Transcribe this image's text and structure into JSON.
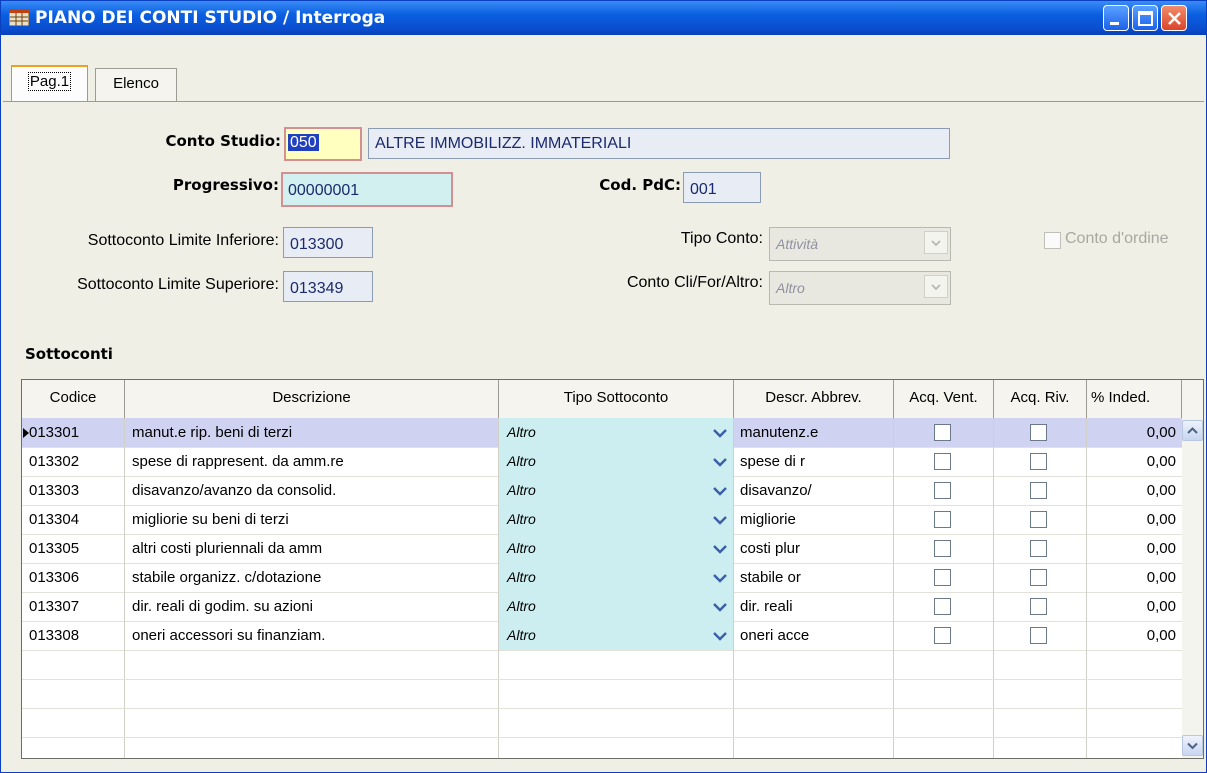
{
  "window": {
    "title": "PIANO DEI CONTI STUDIO / Interroga"
  },
  "tabs": [
    {
      "label": "Pag.1",
      "active": true
    },
    {
      "label": "Elenco",
      "active": false
    }
  ],
  "form": {
    "conto_studio": {
      "label": "Conto Studio:",
      "code": "050",
      "description": "ALTRE IMMOBILIZZ. IMMATERIALI"
    },
    "progressivo": {
      "label": "Progressivo:",
      "value": "00000001"
    },
    "cod_pdc": {
      "label": "Cod. PdC:",
      "value": "001"
    },
    "limite_inferiore": {
      "label": "Sottoconto Limite Inferiore:",
      "value": "013300"
    },
    "limite_superiore": {
      "label": "Sottoconto Limite Superiore:",
      "value": "013349"
    },
    "tipo_conto": {
      "label": "Tipo Conto:",
      "value": "Attività"
    },
    "conto_cli_for": {
      "label": "Conto Cli/For/Altro:",
      "value": "Altro"
    },
    "conto_ordine": {
      "label": "Conto d'ordine",
      "checked": false
    }
  },
  "sottoconti": {
    "section_title": "Sottoconti",
    "columns": [
      "Codice",
      "Descrizione",
      "Tipo Sottoconto",
      "Descr. Abbrev.",
      "Acq. Vent.",
      "Acq. Riv.",
      "% Inded."
    ],
    "rows": [
      {
        "codice": "013301",
        "descrizione": "manut.e rip. beni di terzi",
        "tipo": "Altro",
        "abbrev": "manutenz.e",
        "acq_vent": false,
        "acq_riv": false,
        "inded": "0,00"
      },
      {
        "codice": "013302",
        "descrizione": "spese di rappresent. da amm.re",
        "tipo": "Altro",
        "abbrev": "spese di r",
        "acq_vent": false,
        "acq_riv": false,
        "inded": "0,00"
      },
      {
        "codice": "013303",
        "descrizione": "disavanzo/avanzo da consolid.",
        "tipo": "Altro",
        "abbrev": "disavanzo/",
        "acq_vent": false,
        "acq_riv": false,
        "inded": "0,00"
      },
      {
        "codice": "013304",
        "descrizione": "migliorie su beni di terzi",
        "tipo": "Altro",
        "abbrev": "migliorie",
        "acq_vent": false,
        "acq_riv": false,
        "inded": "0,00"
      },
      {
        "codice": "013305",
        "descrizione": "altri costi pluriennali da amm",
        "tipo": "Altro",
        "abbrev": "costi plur",
        "acq_vent": false,
        "acq_riv": false,
        "inded": "0,00"
      },
      {
        "codice": "013306",
        "descrizione": "stabile organizz. c/dotazione",
        "tipo": "Altro",
        "abbrev": "stabile or",
        "acq_vent": false,
        "acq_riv": false,
        "inded": "0,00"
      },
      {
        "codice": "013307",
        "descrizione": "dir. reali di godim. su azioni",
        "tipo": "Altro",
        "abbrev": "dir. reali",
        "acq_vent": false,
        "acq_riv": false,
        "inded": "0,00"
      },
      {
        "codice": "013308",
        "descrizione": "oneri accessori su finanziam.",
        "tipo": "Altro",
        "abbrev": "oneri acce",
        "acq_vent": false,
        "acq_riv": false,
        "inded": "0,00"
      }
    ]
  }
}
